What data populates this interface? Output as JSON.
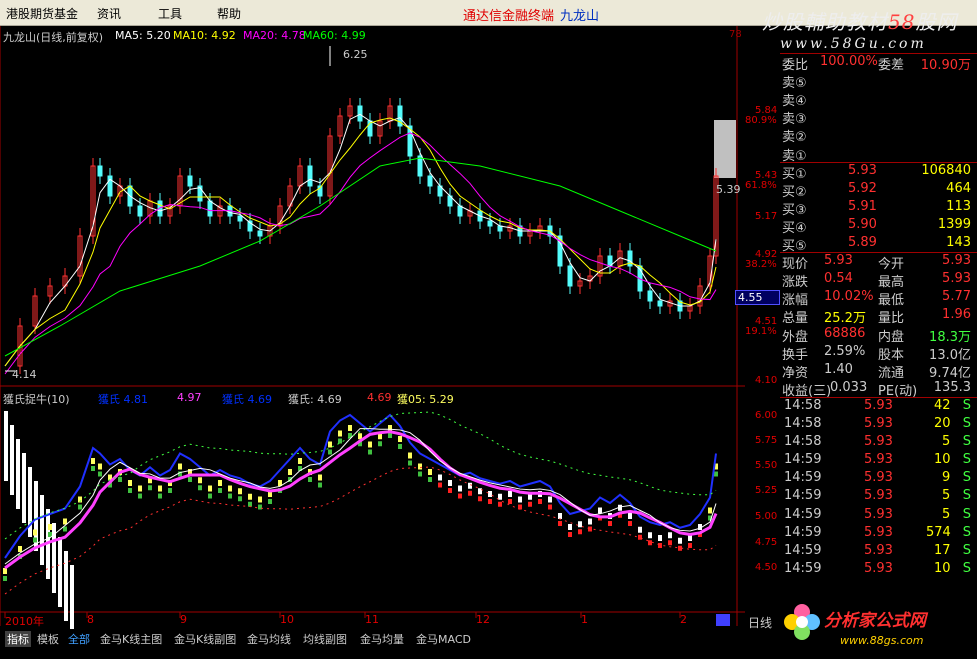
{
  "menu": [
    "港股期货基金",
    "资讯",
    "工具",
    "帮助"
  ],
  "app_title": {
    "left": "通达信金融终端",
    "right": "九龙山"
  },
  "watermark_top": {
    "text": "炒股輔助教材",
    "num": "58",
    "tail": "股网",
    "url": "www.58Gu.com"
  },
  "chart_header": {
    "name": "九龙山(日线,前复权)",
    "ma5": "MA5: 5.20",
    "ma10": "MA10: 4.92",
    "ma20": "MA20: 4.78",
    "ma60": "MA60: 4.99"
  },
  "price_labels": {
    "high": "6.25",
    "low": "4.14",
    "last": "5.39"
  },
  "right_axis": [
    {
      "v": "5.84",
      "p": "80.9%"
    },
    {
      "v": "5.43",
      "p": "61.8%"
    },
    {
      "v": "5.17",
      "p": ""
    },
    {
      "v": "4.92",
      "p": "38.2%"
    },
    {
      "v": "4.51",
      "p": "19.1%"
    },
    {
      "v": "4.10",
      "p": ""
    }
  ],
  "current_price_tag": "4.55",
  "axis_top_num": "78",
  "indicator_header": {
    "name": "獲氏捉牛(10)",
    "a1": "獲氏 4.81",
    "a2": "4.97",
    "a3": "獲氏 4.69",
    "a4": "獲氏: 4.69",
    "a5": "4.69",
    "a6": "獲05: 5.29"
  },
  "indicator_axis": [
    "6.00",
    "5.75",
    "5.50",
    "5.25",
    "5.00",
    "4.75",
    "4.50"
  ],
  "x_axis": [
    "2010年",
    "8",
    "9",
    "10",
    "11",
    "12",
    "1",
    "2"
  ],
  "timeframe": "日线",
  "tabs": [
    "指标",
    "模板",
    "全部",
    "金马K线主图",
    "金马K线副图",
    "金马均线",
    "均线副图",
    "金马均量",
    "金马MACD"
  ],
  "side": {
    "wei": [
      {
        "l": "委比",
        "v": "100.00%",
        "l2": "委差",
        "v2": "10.90万"
      }
    ],
    "sells": [
      "卖⑤",
      "卖④",
      "卖③",
      "卖②",
      "卖①"
    ],
    "buys": [
      {
        "l": "买①",
        "p": "5.93",
        "q": "106840"
      },
      {
        "l": "买②",
        "p": "5.92",
        "q": "464"
      },
      {
        "l": "买③",
        "p": "5.91",
        "q": "113"
      },
      {
        "l": "买④",
        "p": "5.90",
        "q": "1399"
      },
      {
        "l": "买⑤",
        "p": "5.89",
        "q": "143"
      }
    ],
    "quote": [
      {
        "l": "现价",
        "v": "5.93",
        "l2": "今开",
        "v2": "5.93"
      },
      {
        "l": "涨跌",
        "v": "0.54",
        "l2": "最高",
        "v2": "5.93"
      },
      {
        "l": "涨幅",
        "v": "10.02%",
        "l2": "最低",
        "v2": "5.77"
      },
      {
        "l": "总量",
        "v": "25.2万",
        "l2": "量比",
        "v2": "1.96"
      },
      {
        "l": "外盘",
        "v": "68886",
        "l2": "内盘",
        "v2": "18.3万"
      },
      {
        "l": "换手",
        "v": "2.59%",
        "l2": "股本",
        "v2": "13.0亿"
      },
      {
        "l": "净资",
        "v": "1.40",
        "l2": "流通",
        "v2": "9.74亿"
      },
      {
        "l": "收益(三)",
        "v": "0.033",
        "l2": "PE(动)",
        "v2": "135.3"
      }
    ],
    "ticks": [
      {
        "t": "14:58",
        "p": "5.93",
        "q": "42",
        "d": "S"
      },
      {
        "t": "14:58",
        "p": "5.93",
        "q": "20",
        "d": "S"
      },
      {
        "t": "14:58",
        "p": "5.93",
        "q": "5",
        "d": "S"
      },
      {
        "t": "14:59",
        "p": "5.93",
        "q": "10",
        "d": "S"
      },
      {
        "t": "14:59",
        "p": "5.93",
        "q": "9",
        "d": "S"
      },
      {
        "t": "14:59",
        "p": "5.93",
        "q": "5",
        "d": "S"
      },
      {
        "t": "14:59",
        "p": "5.93",
        "q": "5",
        "d": "S"
      },
      {
        "t": "14:59",
        "p": "5.93",
        "q": "574",
        "d": "S"
      },
      {
        "t": "14:59",
        "p": "5.93",
        "q": "17",
        "d": "S"
      },
      {
        "t": "14:59",
        "p": "5.93",
        "q": "10",
        "d": "S"
      }
    ]
  },
  "logo": {
    "text": "分析家公式网",
    "url": "www.88gs.com"
  },
  "colors": {
    "up": "#ff3232",
    "down": "#54fcfc",
    "ma5": "#ffffff",
    "ma10": "#ffff00",
    "ma20": "#ff00ff",
    "ma60": "#00ff00"
  }
}
